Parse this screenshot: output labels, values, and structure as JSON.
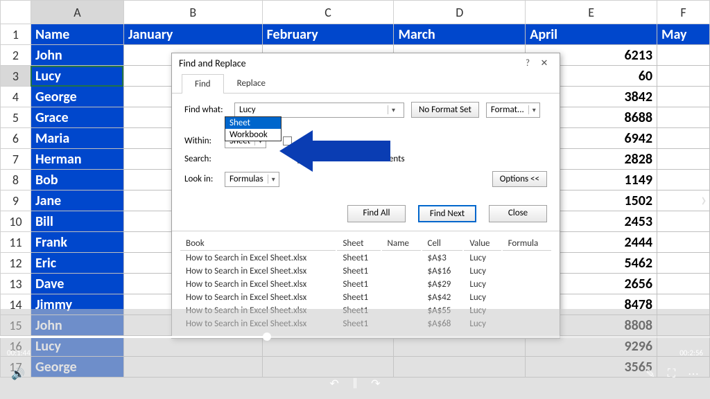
{
  "sheet": {
    "cols": [
      "A",
      "B",
      "C",
      "D",
      "E",
      "F"
    ],
    "col_headers": [
      "Name",
      "January",
      "February",
      "March",
      "April",
      "May"
    ],
    "rows": [
      {
        "n": "1",
        "name": "Name",
        "vals": [
          "",
          "",
          "",
          "",
          ""
        ]
      },
      {
        "n": "2",
        "name": "John",
        "vals": [
          "",
          "",
          "",
          "6213",
          ""
        ]
      },
      {
        "n": "3",
        "name": "Lucy",
        "vals": [
          "",
          "",
          "",
          "60",
          ""
        ]
      },
      {
        "n": "4",
        "name": "George",
        "vals": [
          "",
          "",
          "",
          "3842",
          ""
        ]
      },
      {
        "n": "5",
        "name": "Grace",
        "vals": [
          "",
          "",
          "",
          "8688",
          ""
        ]
      },
      {
        "n": "6",
        "name": "Maria",
        "vals": [
          "",
          "",
          "",
          "6942",
          ""
        ]
      },
      {
        "n": "7",
        "name": "Herman",
        "vals": [
          "",
          "",
          "",
          "2828",
          ""
        ]
      },
      {
        "n": "8",
        "name": "Bob",
        "vals": [
          "",
          "",
          "",
          "1149",
          ""
        ]
      },
      {
        "n": "9",
        "name": "Jane",
        "vals": [
          "",
          "",
          "",
          "1502",
          ""
        ]
      },
      {
        "n": "10",
        "name": "Bill",
        "vals": [
          "",
          "",
          "",
          "2453",
          ""
        ]
      },
      {
        "n": "11",
        "name": "Frank",
        "vals": [
          "",
          "",
          "",
          "2444",
          ""
        ]
      },
      {
        "n": "12",
        "name": "Eric",
        "vals": [
          "",
          "",
          "",
          "5462",
          ""
        ]
      },
      {
        "n": "13",
        "name": "Dave",
        "vals": [
          "",
          "",
          "",
          "2656",
          ""
        ]
      },
      {
        "n": "14",
        "name": "Jimmy",
        "vals": [
          "",
          "",
          "",
          "8478",
          ""
        ]
      },
      {
        "n": "15",
        "name": "John",
        "vals": [
          "",
          "",
          "",
          "8808",
          ""
        ]
      },
      {
        "n": "16",
        "name": "Lucy",
        "vals": [
          "",
          "",
          "",
          "9296",
          ""
        ]
      },
      {
        "n": "17",
        "name": "George",
        "vals": [
          "",
          "",
          "",
          "3565",
          ""
        ]
      }
    ],
    "selected_cell": "A3"
  },
  "dialog": {
    "title": "Find and Replace",
    "tab_find": "Find",
    "tab_replace": "Replace",
    "find_what_label": "Find what:",
    "find_what_value": "Lucy",
    "no_format": "No Format Set",
    "format_btn": "Format...",
    "within_label": "Within:",
    "within_value": "Sheet",
    "within_opts": [
      "Sheet",
      "Workbook"
    ],
    "search_label": "Search:",
    "match_cell": "Match entire cell contents",
    "lookin_label": "Look in:",
    "lookin_value": "Formulas",
    "options_btn": "Options <<",
    "find_all": "Find All",
    "find_next": "Find Next",
    "close": "Close",
    "res_head": {
      "book": "Book",
      "sheet": "Sheet",
      "name": "Name",
      "cell": "Cell",
      "value": "Value",
      "formula": "Formula"
    },
    "results": [
      {
        "book": "How to Search in Excel Sheet.xlsx",
        "sheet": "Sheet1",
        "name": "",
        "cell": "$A$3",
        "value": "Lucy"
      },
      {
        "book": "How to Search in Excel Sheet.xlsx",
        "sheet": "Sheet1",
        "name": "",
        "cell": "$A$16",
        "value": "Lucy"
      },
      {
        "book": "How to Search in Excel Sheet.xlsx",
        "sheet": "Sheet1",
        "name": "",
        "cell": "$A$29",
        "value": "Lucy"
      },
      {
        "book": "How to Search in Excel Sheet.xlsx",
        "sheet": "Sheet1",
        "name": "",
        "cell": "$A$42",
        "value": "Lucy"
      },
      {
        "book": "How to Search in Excel Sheet.xlsx",
        "sheet": "Sheet1",
        "name": "",
        "cell": "$A$55",
        "value": "Lucy"
      },
      {
        "book": "How to Search in Excel Sheet.xlsx",
        "sheet": "Sheet1",
        "name": "",
        "cell": "$A$68",
        "value": "Lucy"
      }
    ]
  },
  "video": {
    "time_left": "00:1:44",
    "time_right": "00:2:56"
  }
}
